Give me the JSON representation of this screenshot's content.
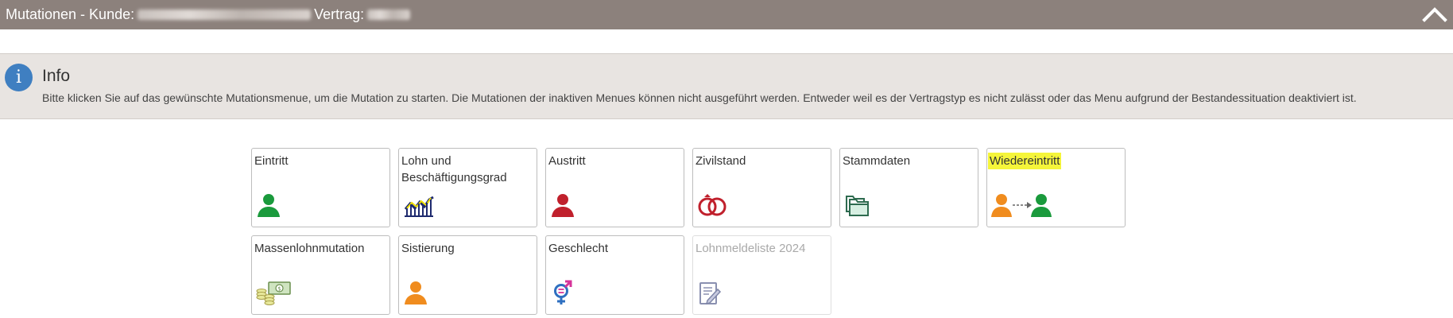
{
  "header": {
    "title_prefix": "Mutationen - Kunde:",
    "contract_label": "Vertrag:",
    "collapse_icon": "chevron-up-icon"
  },
  "info": {
    "icon": "info-icon",
    "title": "Info",
    "text": "Bitte klicken Sie auf das gewünschte Mutationsmenue, um die Mutation zu starten. Die Mutationen der inaktiven Menues können nicht ausgeführt werden. Entweder weil es der Vertragstyp es nicht zulässt oder das Menu aufgrund der Bestandessituation deaktiviert ist."
  },
  "tiles": [
    {
      "label": "Eintritt",
      "icon": "person-green-icon",
      "enabled": true
    },
    {
      "label": "Lohn und Beschäftigungsgrad",
      "icon": "salary-chart-icon",
      "enabled": true
    },
    {
      "label": "Austritt",
      "icon": "person-red-icon",
      "enabled": true
    },
    {
      "label": "Zivilstand",
      "icon": "wedding-rings-icon",
      "enabled": true
    },
    {
      "label": "Stammdaten",
      "icon": "folders-icon",
      "enabled": true
    },
    {
      "label": "Wiedereintritt",
      "icon": "reentry-persons-icon",
      "enabled": true,
      "highlighted": true
    },
    {
      "label": "Massenlohnmutation",
      "icon": "money-stack-icon",
      "enabled": true
    },
    {
      "label": "Sistierung",
      "icon": "person-orange-icon",
      "enabled": true
    },
    {
      "label": "Geschlecht",
      "icon": "gender-icon",
      "enabled": true
    },
    {
      "label": "Lohnmeldeliste 2024",
      "icon": "document-edit-icon",
      "enabled": false
    }
  ],
  "colors": {
    "header_bg": "#8c817c",
    "info_bg": "#e8e4e1",
    "info_icon": "#3f7fc1",
    "highlight": "#f5f53a",
    "green": "#1a9a3c",
    "red": "#c0202c",
    "orange": "#f08c1e"
  }
}
